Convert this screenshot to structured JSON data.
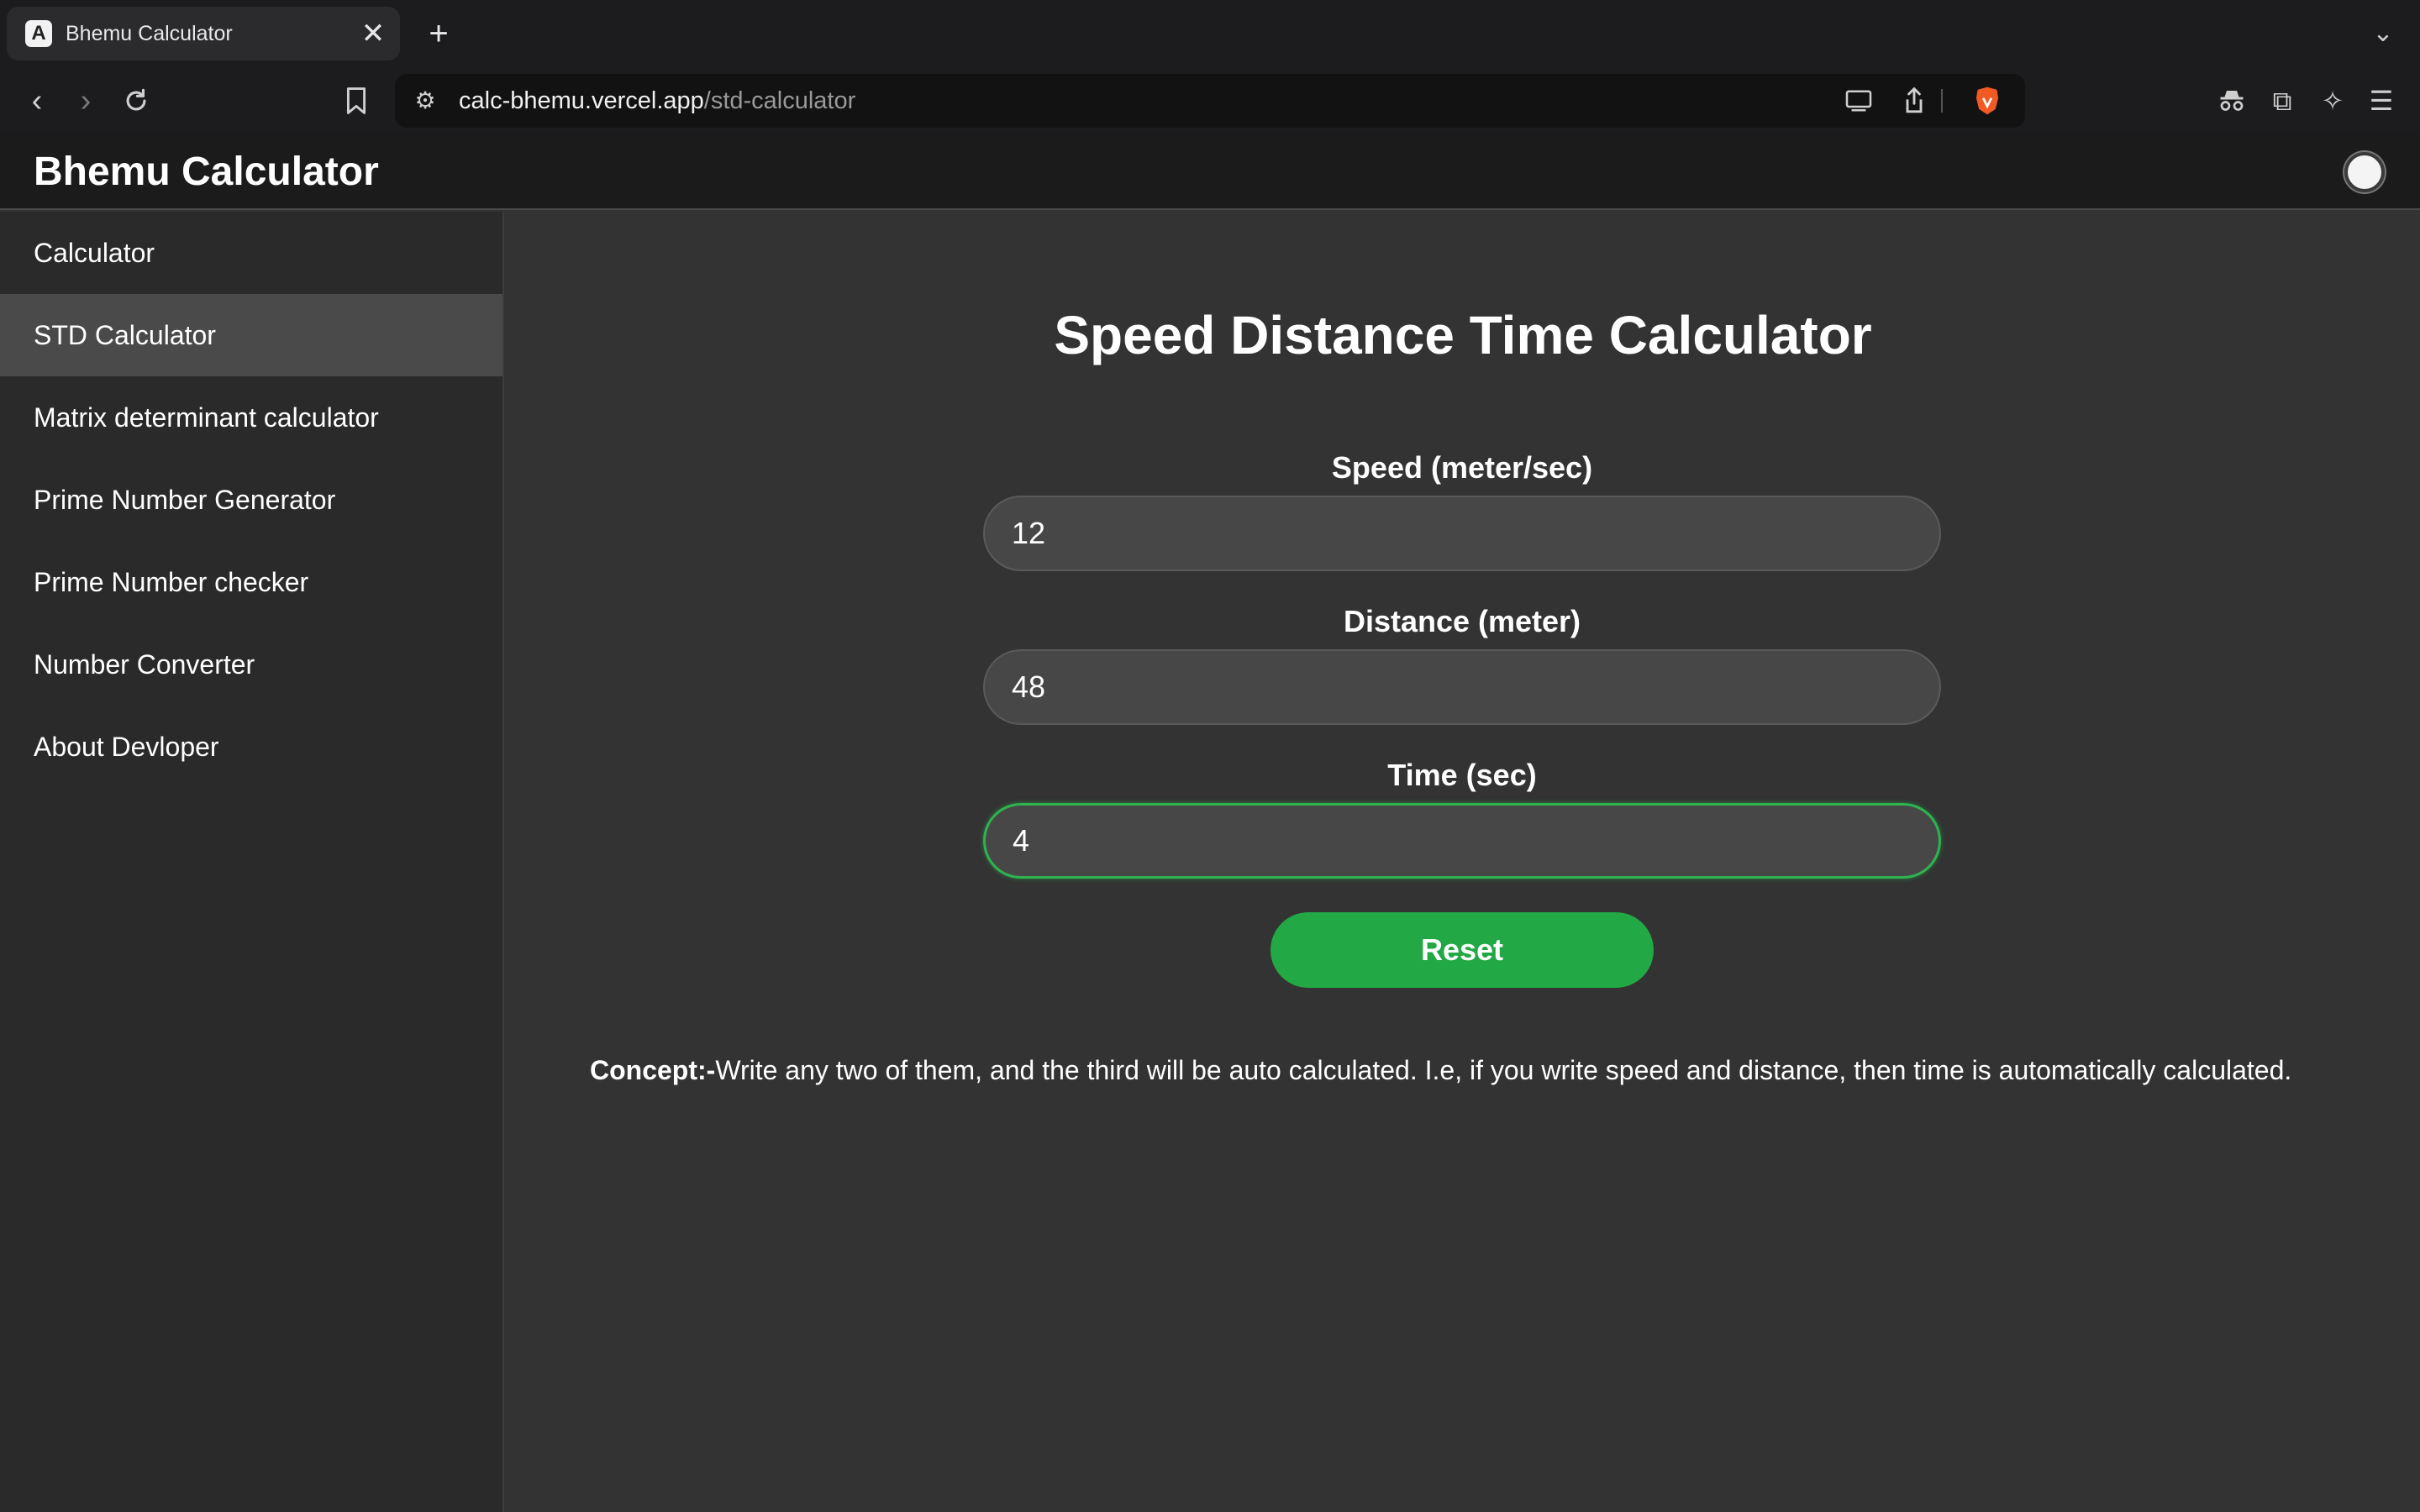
{
  "browser": {
    "tab_title": "Bhemu Calculator",
    "tab_close": "✕",
    "new_tab": "+",
    "url_host": "calc-bhemu.vercel.app",
    "url_path": "/std-calculator"
  },
  "app": {
    "title": "Bhemu Calculator"
  },
  "sidebar": {
    "items": [
      {
        "label": "Calculator"
      },
      {
        "label": "STD Calculator"
      },
      {
        "label": "Matrix determinant calculator"
      },
      {
        "label": "Prime Number Generator"
      },
      {
        "label": "Prime Number checker"
      },
      {
        "label": "Number Converter"
      },
      {
        "label": "About Devloper"
      }
    ],
    "active_index": 1
  },
  "main": {
    "title": "Speed Distance Time Calculator",
    "speed": {
      "label": "Speed (meter/sec)",
      "value": "12"
    },
    "distance": {
      "label": "Distance (meter)",
      "value": "48"
    },
    "time": {
      "label": "Time (sec)",
      "value": "4"
    },
    "reset_label": "Reset",
    "concept_prefix": "Concept:-",
    "concept_text": "Write any two of them, and the third will be auto calculated. I.e, if you write speed and distance, then time is automatically calculated."
  },
  "colors": {
    "accent_green": "#22a845",
    "background": "#333333",
    "sidebar_active": "#4a4a4a"
  }
}
